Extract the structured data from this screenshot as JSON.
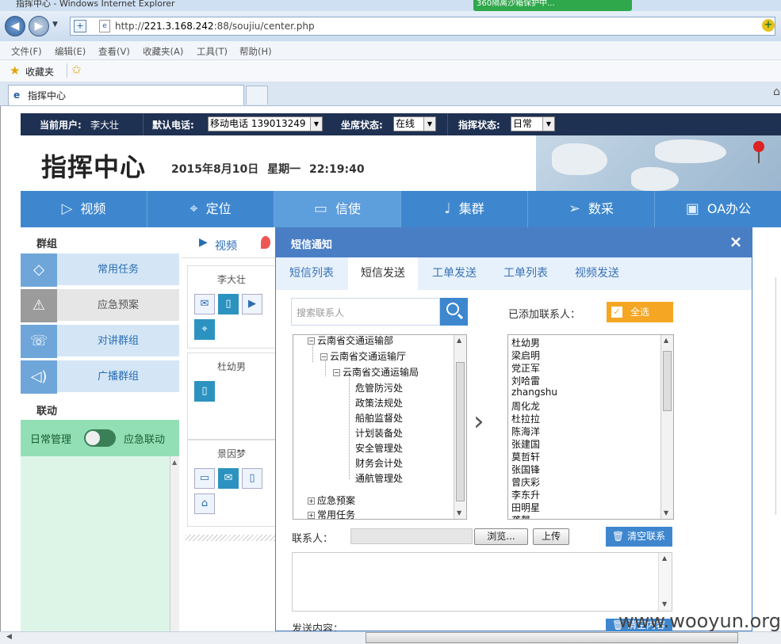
{
  "browser": {
    "title": "指挥中心 - Windows Internet Explorer",
    "toolbar_360": "360隔离沙箱保护中...",
    "url_prefix": "http://",
    "url_host": "221.3.168.242",
    "url_rest": ":88/soujiu/center.php",
    "menu": [
      "文件(F)",
      "编辑(E)",
      "查看(V)",
      "收藏夹(A)",
      "工具(T)",
      "帮助(H)"
    ],
    "favorites": "收藏夹",
    "tab_title": "指挥中心"
  },
  "userbar": {
    "user_label": "当前用户:",
    "user": "李大壮",
    "phone_label": "默认电话:",
    "phone_value": "移动电话  139013249",
    "seat_label": "坐席状态:",
    "seat_value": "在线",
    "command_label": "指挥状态:",
    "command_value": "日常"
  },
  "header": {
    "logo": "指挥中心",
    "date": "2015年8月10日",
    "weekday": "星期一",
    "time": "22:19:40"
  },
  "nav": [
    {
      "label": "视频",
      "icon": "▷"
    },
    {
      "label": "定位",
      "icon": "⌖"
    },
    {
      "label": "信使",
      "icon": "▭"
    },
    {
      "label": "集群",
      "icon": "♩"
    },
    {
      "label": "数采",
      "icon": "➢"
    },
    {
      "label": "OA办公",
      "icon": "▣"
    }
  ],
  "sidebar": {
    "group_title": "群组",
    "items": [
      {
        "label": "常用任务",
        "icon": "◇"
      },
      {
        "label": "应急预案",
        "icon": "⚠"
      },
      {
        "label": "对讲群组",
        "icon": "☏"
      },
      {
        "label": "广播群组",
        "icon": "◁)"
      }
    ],
    "link_title": "联动",
    "toggle_left": "日常管理",
    "toggle_right": "应急联动"
  },
  "contacts": {
    "subnav_label": "视频",
    "cards": [
      {
        "name": "李大壮"
      },
      {
        "name": "杜幼男"
      },
      {
        "name": "景因梦"
      }
    ]
  },
  "modal": {
    "title": "短信通知",
    "close": "×",
    "tabs": [
      "短信列表",
      "短信发送",
      "工单发送",
      "工单列表",
      "视频发送"
    ],
    "search_placeholder": "搜索联系人",
    "added_label": "已添加联系人：",
    "select_all": "全选",
    "tree": [
      "云南省交通运输部",
      "云南省交通运输厅",
      "云南省交通运输局",
      "危管防污处",
      "政策法规处",
      "船舶监督处",
      "计划装备处",
      "安全管理处",
      "财务会计处",
      "通航管理处",
      "应急预案",
      "常用任务"
    ],
    "added_contacts": [
      "杜幼男",
      "梁启明",
      "党正军",
      "刘哈雷",
      "zhangshu",
      "周化龙",
      "杜拉拉",
      "陈海洋",
      "张建国",
      "莫哲轩",
      "张国锋",
      "曾庆彩",
      "李东升",
      "田明星",
      "龚馨"
    ],
    "contact_label": "联系人：",
    "browse": "浏览...",
    "upload": "上传",
    "clear": "清空联系人",
    "send_label": "发送内容：",
    "bottom_btn": "清空内容"
  },
  "watermark": "www.wooyun.org"
}
